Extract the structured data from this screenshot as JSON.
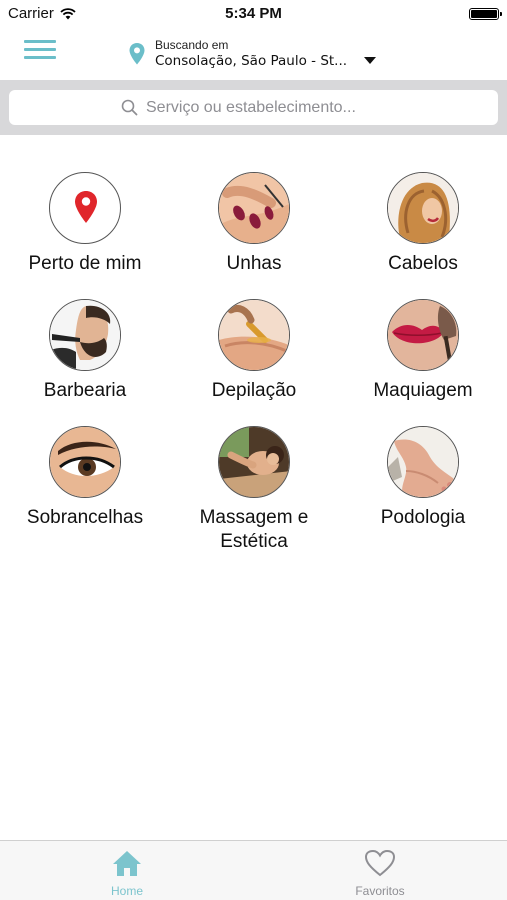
{
  "status_bar": {
    "carrier": "Carrier",
    "time": "5:34 PM"
  },
  "nav": {
    "location_label": "Buscando em",
    "location_value": "Consolação, São Paulo - St..."
  },
  "search": {
    "placeholder": "Serviço ou estabelecimento..."
  },
  "categories": [
    {
      "label": "Perto de mim",
      "icon": "location-pin-icon"
    },
    {
      "label": "Unhas",
      "icon": "nails-photo"
    },
    {
      "label": "Cabelos",
      "icon": "hair-photo"
    },
    {
      "label": "Barbearia",
      "icon": "barber-photo"
    },
    {
      "label": "Depilação",
      "icon": "waxing-photo"
    },
    {
      "label": "Maquiagem",
      "icon": "makeup-photo"
    },
    {
      "label": "Sobrancelhas",
      "icon": "eyebrow-photo"
    },
    {
      "label": "Massagem e Estética",
      "icon": "massage-photo"
    },
    {
      "label": "Podologia",
      "icon": "feet-photo"
    }
  ],
  "tabs": {
    "home": "Home",
    "favorites": "Favoritos"
  },
  "colors": {
    "accent": "#6bbec9",
    "pin_red": "#e0262b",
    "search_bg": "#d8d8da"
  }
}
